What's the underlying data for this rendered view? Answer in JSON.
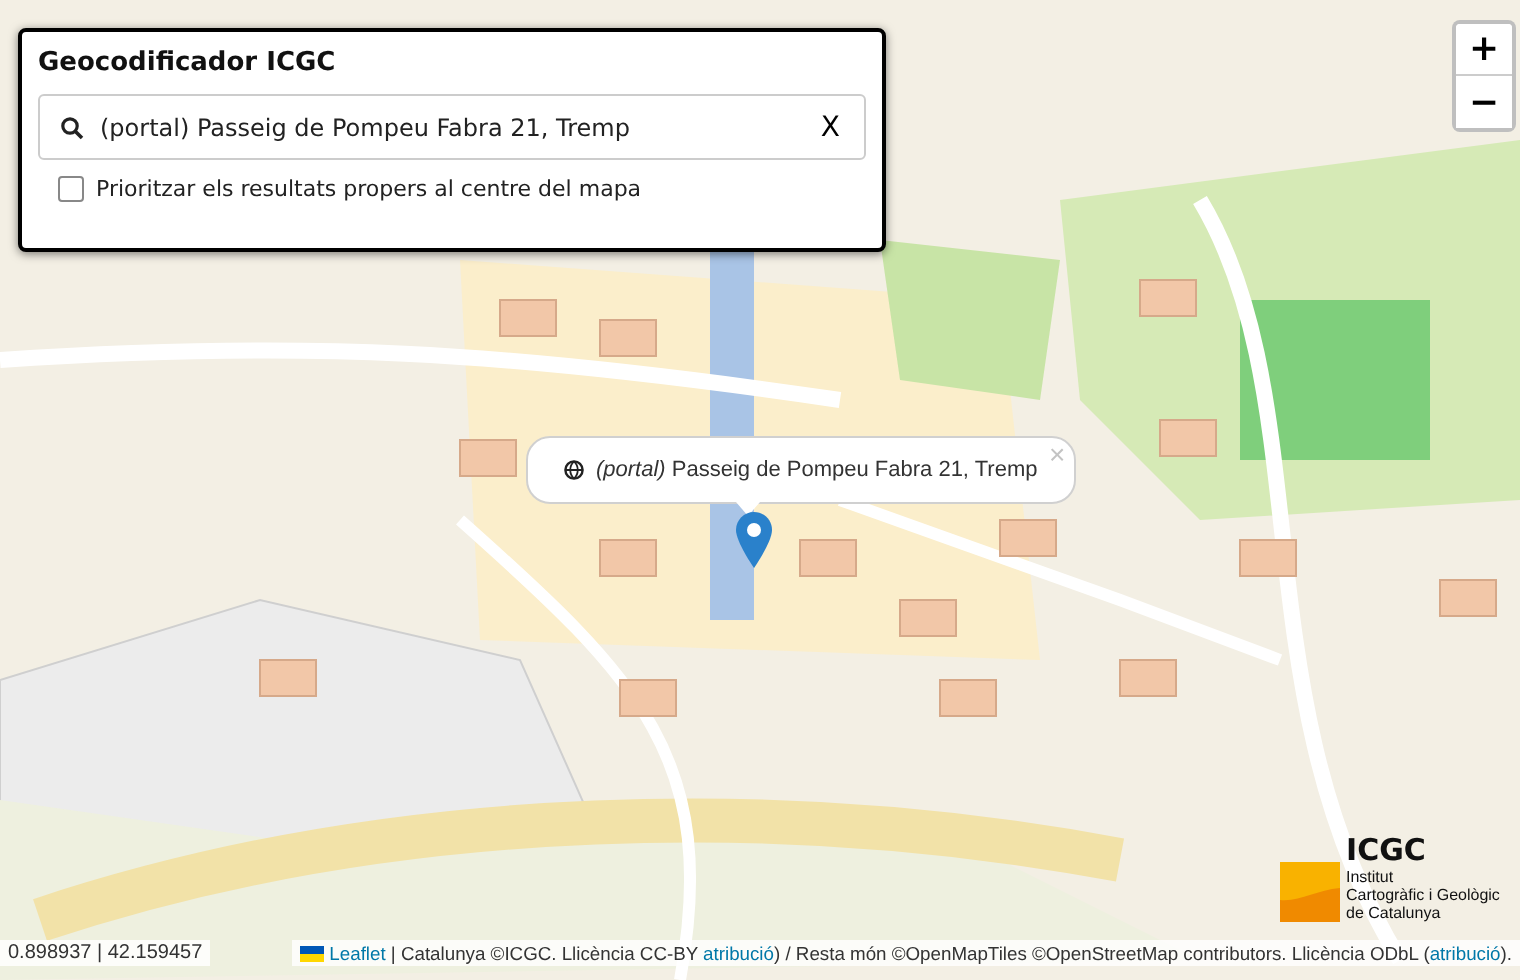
{
  "geocoder": {
    "title": "Geocodificador ICGC",
    "search": {
      "value": "(portal) Passeig de Pompeu Fabra 21, Tremp",
      "clear": "X"
    },
    "option": {
      "label": "Prioritzar els resultats propers al centre del mapa",
      "checked": false
    }
  },
  "zoom": {
    "in": "+",
    "out": "−"
  },
  "popup": {
    "text": "*(portal)* Passeig de Pompeu Fabra 21, Tremp",
    "close": "×"
  },
  "logo": {
    "name": "ICGC",
    "lines": [
      "Institut",
      "Cartogràfic i Geològic",
      "de Catalunya"
    ]
  },
  "coordinates": "0.898937 | 42.159457",
  "attribution": [
    {
      "kind": "link",
      "text": "Leaflet"
    },
    {
      "kind": "text",
      "text": " | Catalunya ©ICGC. Llicència CC-BY "
    },
    {
      "kind": "link",
      "text": "atribució"
    },
    {
      "kind": "text",
      "text": ") / Resta món ©OpenMapTiles ©OpenStreetMap contributors. Llicència ODbL ("
    },
    {
      "kind": "link",
      "text": "atribució"
    },
    {
      "kind": "text",
      "text": ")."
    }
  ]
}
